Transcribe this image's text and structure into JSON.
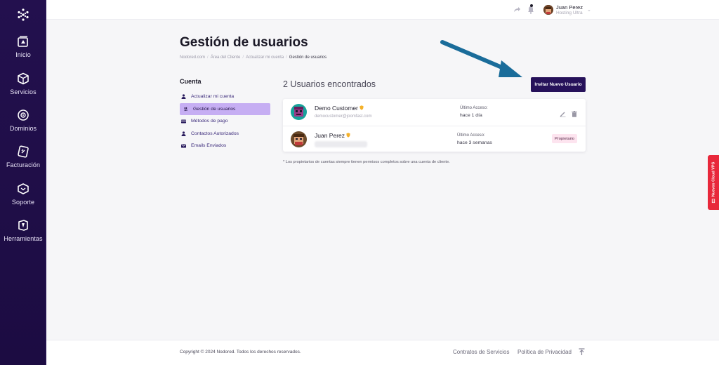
{
  "sidebar": {
    "items": [
      {
        "label": "Inicio",
        "icon": "home-icon"
      },
      {
        "label": "Servicios",
        "icon": "box-icon"
      },
      {
        "label": "Dominios",
        "icon": "globe-icon"
      },
      {
        "label": "Facturación",
        "icon": "invoice-icon"
      },
      {
        "label": "Soporte",
        "icon": "support-icon"
      },
      {
        "label": "Herramientas",
        "icon": "tools-icon"
      }
    ]
  },
  "header": {
    "user_name": "Juan Perez",
    "user_plan": "Hosting Ultra"
  },
  "page": {
    "title": "Gestión de usuarios",
    "breadcrumb": [
      "Nodored.com",
      "Área del Cliente",
      "Actualizar mi cuenta",
      "Gestión de usuarios"
    ]
  },
  "account_menu": {
    "heading": "Cuenta",
    "items": [
      {
        "label": "Actualizar mi cuenta",
        "icon": "user-icon"
      },
      {
        "label": "Gestión de usuarios",
        "icon": "swap-icon",
        "active": true
      },
      {
        "label": "Métodos de pago",
        "icon": "credit-card-icon"
      },
      {
        "label": "Contactos Autorizados",
        "icon": "user-icon"
      },
      {
        "label": "Emails Enviados",
        "icon": "mail-icon"
      }
    ]
  },
  "users": {
    "count_text": "2 Usuarios encontrados",
    "invite_label": "Invitar Nuevo Usuario",
    "last_access_label": "Último Acceso:",
    "rows": [
      {
        "name": "Demo Customer",
        "email": "democustomer@joomfast.com",
        "last_access": "hace 1 día"
      },
      {
        "name": "Juan Perez",
        "email": "",
        "last_access": "hace 3 semanas",
        "badge": "Propietario"
      }
    ],
    "footnote": "* Los propietarios de cuentas siempre tienen permisos completos sobre una cuenta de cliente."
  },
  "footer": {
    "copyright": "Copyright © 2024 Nodored. Todos los derechos reservados.",
    "links": [
      "Contratos de Servicios",
      "Política de Privacidad"
    ]
  },
  "promo": {
    "label": "Nuevos Cloud VPS"
  },
  "colors": {
    "sidebar_bg": "#23104e",
    "primary_button": "#26115a",
    "active_menu": "#c6aef3",
    "arrow": "#1a6c9a",
    "promo": "#e8283b",
    "owner_badge": "#fde4ef"
  }
}
